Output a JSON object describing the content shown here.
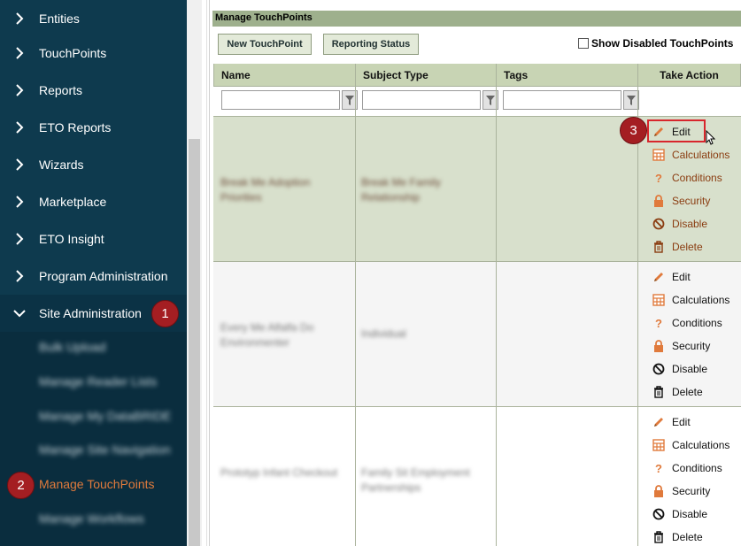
{
  "sidebar": {
    "items": [
      {
        "label": "Entities"
      },
      {
        "label": "TouchPoints"
      },
      {
        "label": "Reports"
      },
      {
        "label": "ETO Reports"
      },
      {
        "label": "Wizards"
      },
      {
        "label": "Marketplace"
      },
      {
        "label": "ETO Insight"
      },
      {
        "label": "Program Administration"
      },
      {
        "label": "Site Administration"
      }
    ],
    "subitems": [
      {
        "label": "Bulk Upload"
      },
      {
        "label": "Manage Reader Lists"
      },
      {
        "label": "Manage My DataBRIDE"
      },
      {
        "label": "Manage Site Navigation"
      },
      {
        "label": "Manage TouchPoints"
      },
      {
        "label": "Manage Workflows"
      }
    ]
  },
  "badges": {
    "one": "1",
    "two": "2",
    "three": "3"
  },
  "panel": {
    "title": "Manage TouchPoints",
    "new_button": "New TouchPoint",
    "reporting_button": "Reporting Status",
    "show_disabled": "Show Disabled TouchPoints"
  },
  "table": {
    "headers": {
      "name": "Name",
      "subject": "Subject Type",
      "tags": "Tags",
      "action": "Take Action"
    },
    "rows": [
      {
        "name": "Break Me Adoption Priorities",
        "subject": "Break Me Family Relationship"
      },
      {
        "name": "Every Me Alfalfa Do Environmenter",
        "subject": "Individual"
      },
      {
        "name": "Prototyp Infant Checkout",
        "subject": "Family Sit Employment Partnerships"
      }
    ],
    "actions": [
      "Edit",
      "Calculations",
      "Conditions",
      "Security",
      "Disable",
      "Delete"
    ]
  },
  "colors": {
    "sidebar_bg": "#0e3a4e",
    "accent_orange": "#e07a3c",
    "badge_red": "#a41e22",
    "header_green": "#9eb08d",
    "selected_row": "#d8e0cc"
  }
}
